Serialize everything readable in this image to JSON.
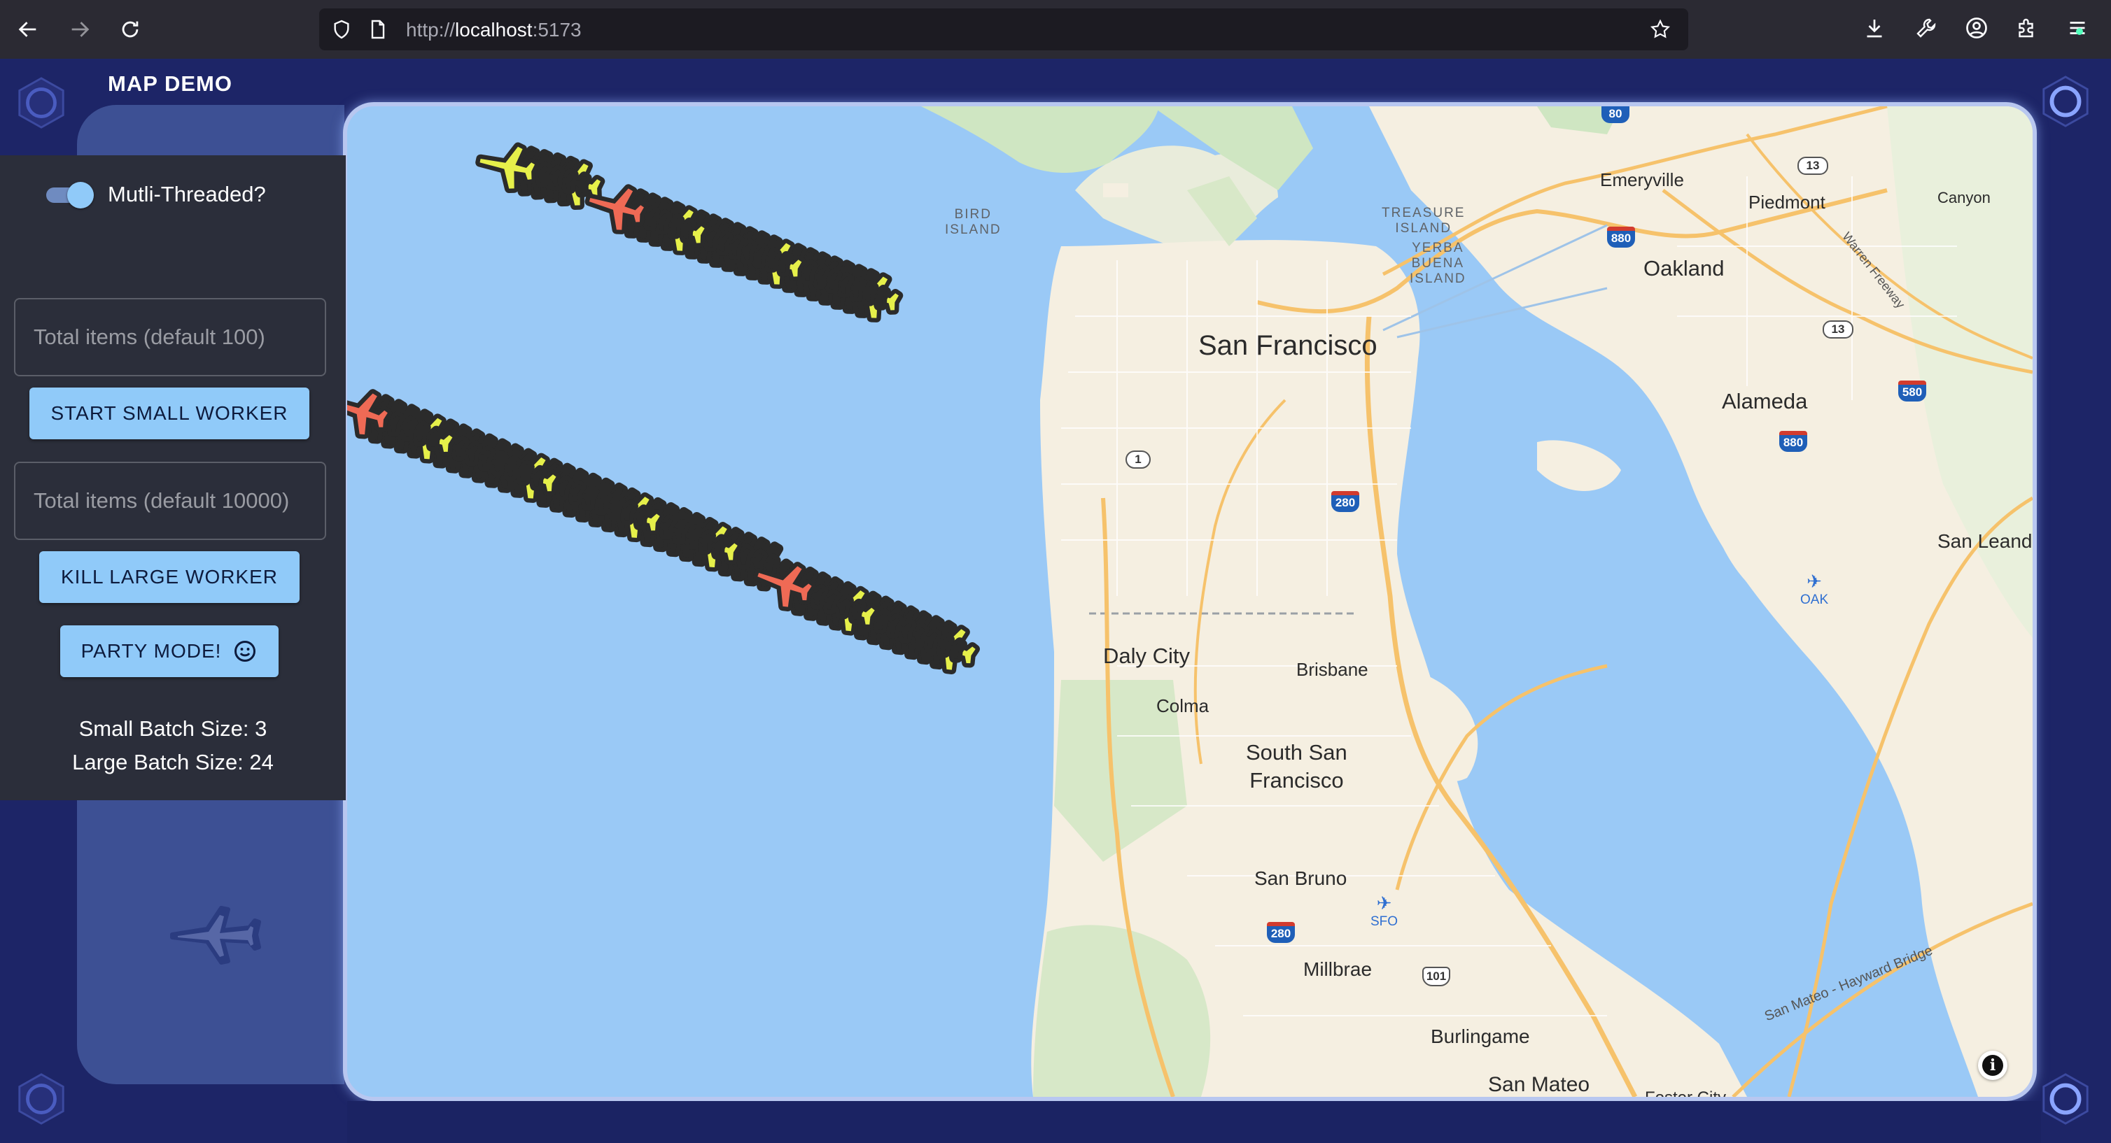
{
  "browser": {
    "url_scheme": "http://",
    "url_host": "localhost",
    "url_port": ":5173"
  },
  "app": {
    "title": "MAP DEMO"
  },
  "controls": {
    "multithread_label": "Mutli-Threaded?",
    "multithread_enabled": true,
    "small_total_placeholder": "Total items (default 100)",
    "start_small_worker_label": "START SMALL WORKER",
    "large_total_placeholder": "Total items (default 10000)",
    "kill_large_worker_label": "KILL LARGE WORKER",
    "party_mode_label": "PARTY MODE!",
    "small_batch_text": "Small Batch Size: 3",
    "large_batch_text": "Large Batch Size: 24"
  },
  "map": {
    "places": {
      "san_francisco": "San Francisco",
      "emeryville": "Emeryville",
      "piedmont": "Piedmont",
      "canyon": "Canyon",
      "oakland": "Oakland",
      "alameda": "Alameda",
      "san_leandro": "San Leandr",
      "daly_city": "Daly City",
      "brisbane": "Brisbane",
      "colma": "Colma",
      "south_sf_line1": "South San",
      "south_sf_line2": "Francisco",
      "san_bruno": "San Bruno",
      "millbrae": "Millbrae",
      "burlingame": "Burlingame",
      "san_mateo": "San Mateo",
      "foster_city": "Foster City",
      "bird_island_1": "BIRD",
      "bird_island_2": "ISLAND",
      "treasure_island_1": "TREASURE",
      "treasure_island_2": "ISLAND",
      "yerba_buena_1": "YERBA",
      "yerba_buena_2": "BUENA",
      "yerba_buena_3": "ISLAND",
      "warren_freeway": "Warren Freeway",
      "san_mateo_bridge": "San Mateo - Hayward Bridge",
      "oak_airport": "OAK",
      "sfo_airport": "SFO"
    },
    "shields": {
      "i80": "80",
      "i880_a": "880",
      "i880_b": "880",
      "i580": "580",
      "i280_a": "280",
      "i280_b": "280",
      "ca13_a": "13",
      "ca13_b": "13",
      "ca1": "1",
      "us101": "101"
    },
    "colors": {
      "water": "#9ac9f6",
      "land": "#f5efe1",
      "park": "#cfe6c2",
      "highway": "#f6c26b",
      "plane_active": "#ef6a55",
      "plane_alt": "#e6f04a",
      "plane_outline": "#2b2b2b"
    }
  }
}
